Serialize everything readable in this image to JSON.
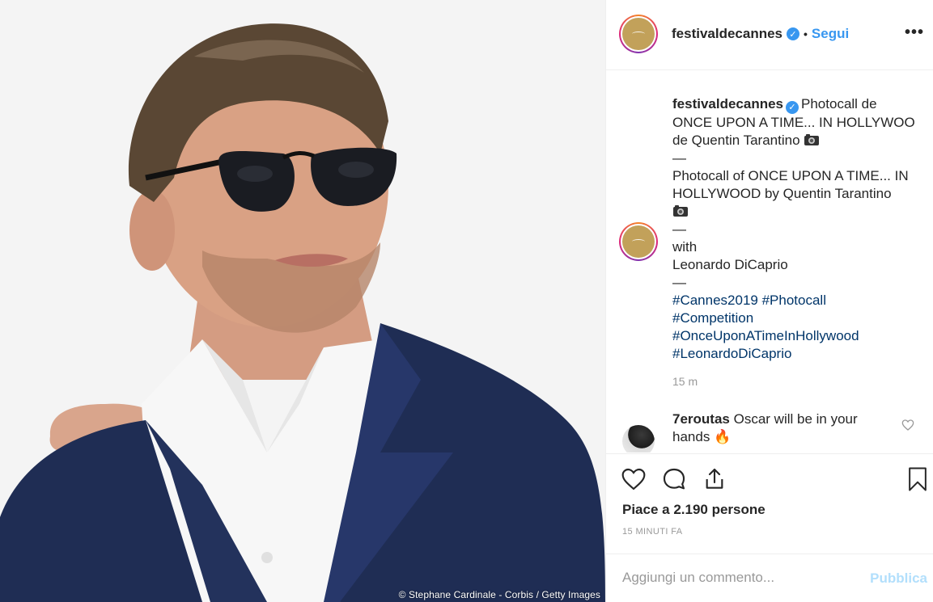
{
  "post": {
    "photo_credit": "© Stephane Cardinale - Corbis / Getty Images",
    "photo_alt": "Man in dark sunglasses and navy blazer at photocall"
  },
  "header": {
    "username": "festivaldecannes",
    "separator": "•",
    "follow_label": "Segui",
    "more_label": "•••"
  },
  "caption": {
    "username": "festivaldecannes",
    "line1": "Photocall de",
    "line2": "ONCE UPON A TIME... IN HOLLYWOO",
    "line3": "de Quentin Tarantino",
    "dash1": "—",
    "line4": "Photocall of ONCE UPON A TIME... IN",
    "line5": "HOLLYWOOD by Quentin Tarantino",
    "dash2": "—",
    "line6": "with",
    "line7": "Leonardo DiCaprio",
    "dash3": "—",
    "hashtags": [
      "#Cannes2019 #Photocall",
      "#Competition",
      "#OnceUponATimeInHollywood",
      "#LeonardoDiCaprio"
    ],
    "time": "15 m"
  },
  "comment": {
    "username": "7eroutas",
    "text": "Oscar will be in your hands",
    "emoji": "🔥"
  },
  "actions": {
    "likes_text": "Piace a 2.190 persone",
    "timestamp": "15 MINUTI FA"
  },
  "comment_box": {
    "placeholder": "Aggiungi un commento...",
    "publish_label": "Pubblica"
  },
  "colors": {
    "link_blue": "#3897f0",
    "hashtag_blue": "#003569",
    "muted": "#999999",
    "publish_disabled": "#b2dffc",
    "avatar_gold": "#c2a15a",
    "blazer_navy": "#1f2d54"
  },
  "icons": [
    "verified-icon",
    "heart-icon",
    "comment-icon",
    "share-icon",
    "bookmark-icon",
    "camera-emoji",
    "small-heart-icon"
  ]
}
